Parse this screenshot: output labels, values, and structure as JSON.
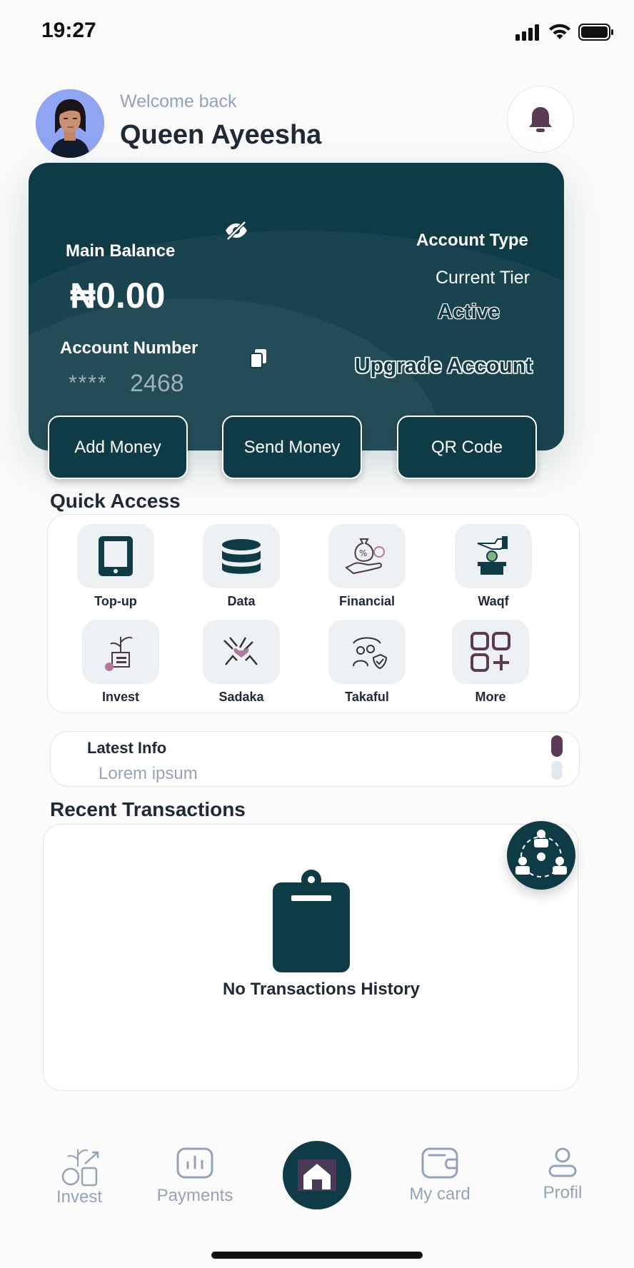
{
  "status_bar": {
    "time": "19:27"
  },
  "header": {
    "welcome": "Welcome back",
    "user_name": "Queen Ayeesha"
  },
  "card": {
    "main_balance_label": "Main Balance",
    "balance": "₦0.00",
    "account_number_label": "Account Number",
    "account_masked": "****",
    "account_last_digits": "2468",
    "account_type_label": "Account Type",
    "tier": "Current Tier",
    "status": "Active",
    "upgrade": "Upgrade Account"
  },
  "actions": {
    "add_money": "Add Money",
    "send_money": "Send Money",
    "qr_code": "QR Code"
  },
  "quick_access": {
    "title": "Quick Access",
    "items": [
      "Top-up",
      "Data",
      "Financial",
      "Waqf",
      "Invest",
      "Sadaka",
      "Takaful",
      "More"
    ]
  },
  "latest_info": {
    "title": "Latest Info",
    "text": "Lorem ipsum"
  },
  "transactions": {
    "title": "Recent Transactions",
    "empty": "No Transactions History"
  },
  "bottom_nav": {
    "invest": "Invest",
    "payments": "Payments",
    "my_card": "My card",
    "profile": "Profil"
  },
  "colors": {
    "primary": "#0f3b47",
    "accent": "#5b3a55",
    "muted": "#94a3b8"
  }
}
